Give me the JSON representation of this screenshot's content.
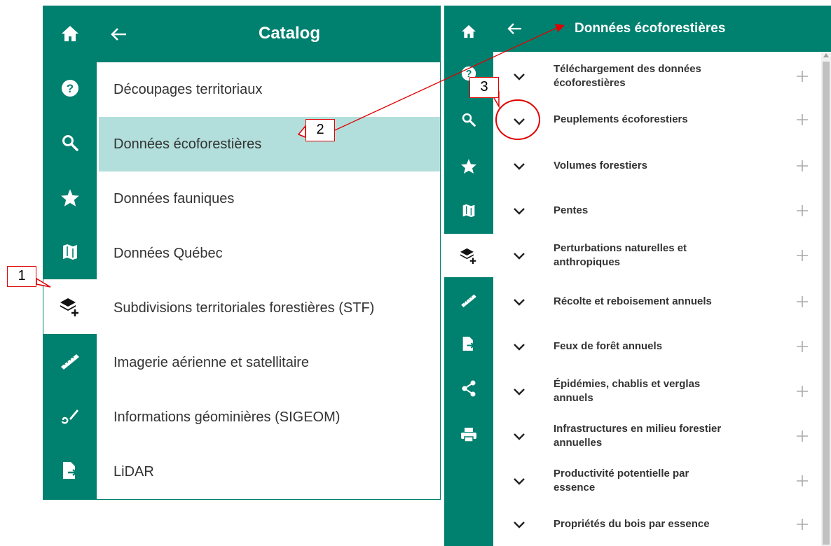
{
  "left_panel": {
    "title": "Catalog",
    "rail": [
      "home-icon",
      "help-icon",
      "search-icon",
      "star-icon",
      "map-icon",
      "layers-add-icon",
      "ruler-icon",
      "draw-icon",
      "file-export-icon"
    ],
    "items": [
      {
        "label": "Découpages territoriaux"
      },
      {
        "label": "Données écoforestières"
      },
      {
        "label": "Données fauniques"
      },
      {
        "label": "Données Québec"
      },
      {
        "label": "Subdivisions territoriales forestières (STF)"
      },
      {
        "label": "Imagerie aérienne et satellitaire"
      },
      {
        "label": "Informations géominières (SIGEOM)"
      },
      {
        "label": "LiDAR"
      }
    ],
    "selected_item": "Données écoforestières"
  },
  "right_panel": {
    "title": "Données écoforestières",
    "rail": [
      "home-icon",
      "help-icon",
      "search-icon",
      "star-icon",
      "map-icon",
      "layers-add-icon",
      "ruler-icon",
      "file-export-icon",
      "share-icon",
      "print-icon"
    ],
    "items": [
      {
        "line1": "Téléchargement des données",
        "line2": "écoforestières"
      },
      {
        "line1": "Peuplements écoforestiers",
        "line2": ""
      },
      {
        "line1": "Volumes forestiers",
        "line2": ""
      },
      {
        "line1": "Pentes",
        "line2": ""
      },
      {
        "line1": "Perturbations naturelles et",
        "line2": "anthropiques"
      },
      {
        "line1": "Récolte et reboisement annuels",
        "line2": ""
      },
      {
        "line1": "Feux de forêt annuels",
        "line2": ""
      },
      {
        "line1": "Épidémies, chablis et verglas",
        "line2": "annuels"
      },
      {
        "line1": "Infrastructures en milieu forestier",
        "line2": "annuelles"
      },
      {
        "line1": "Productivité potentielle par",
        "line2": "essence"
      },
      {
        "line1": "Propriétés du bois par essence",
        "line2": ""
      }
    ]
  },
  "callouts": {
    "one": "1",
    "two": "2",
    "three": "3"
  },
  "colors": {
    "brand_teal": "#00806f",
    "selected_row": "#b2dfdb",
    "annotation_red": "#e00000"
  }
}
